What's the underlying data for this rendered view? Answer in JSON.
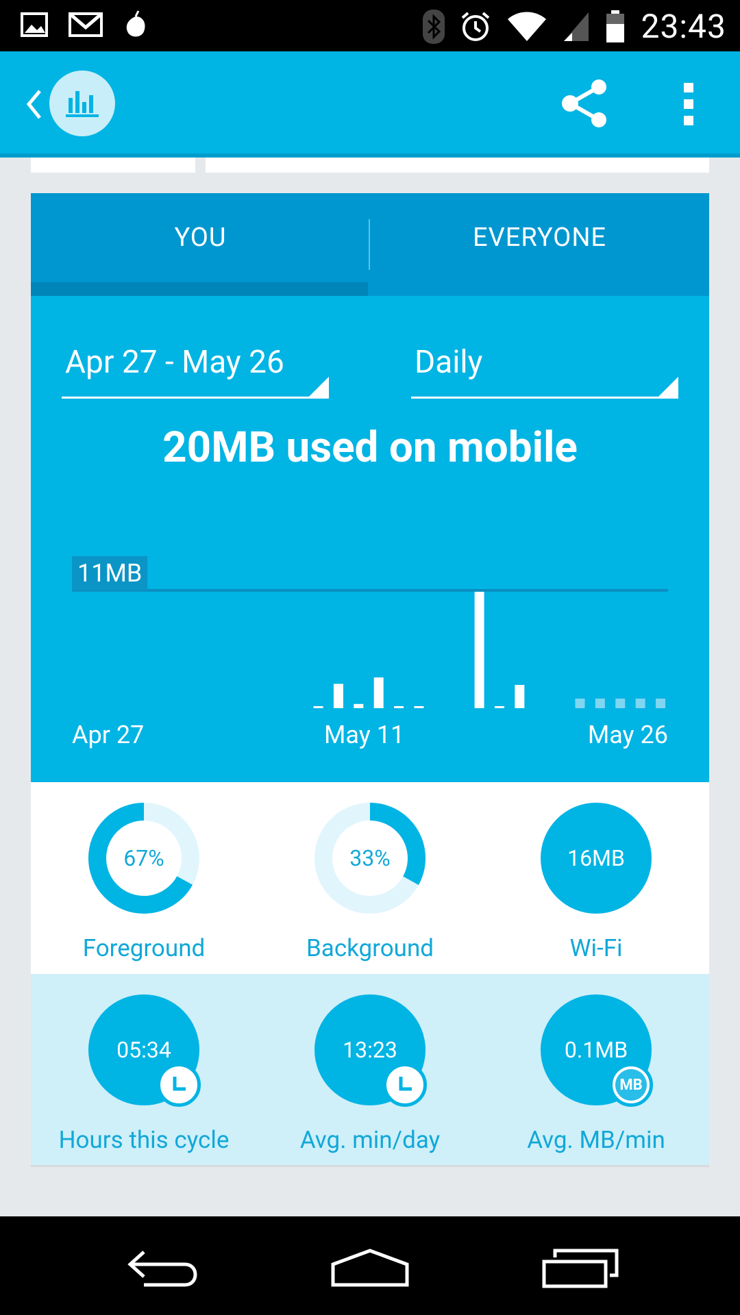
{
  "status_bar": {
    "time": "23:43",
    "left_icons": [
      "gallery-icon",
      "gmail-icon",
      "fruit-icon"
    ],
    "right_icons": [
      "bluetooth-icon",
      "alarm-icon",
      "wifi-icon",
      "cell-signal-icon",
      "battery-icon"
    ]
  },
  "app_bar": {
    "icons": [
      "back-chevron-icon",
      "bar-chart-logo-icon",
      "share-icon",
      "overflow-menu-icon"
    ]
  },
  "tabs": [
    {
      "label": "YOU",
      "selected": true
    },
    {
      "label": "EVERYONE",
      "selected": false
    }
  ],
  "filters": {
    "date_range": "Apr 27 - May 26",
    "period": "Daily"
  },
  "headline": "20MB used on mobile",
  "chart_data": {
    "type": "bar",
    "unit": "MB",
    "max_label": "11MB",
    "ylim": [
      0,
      11
    ],
    "x_tick_labels": [
      "Apr 27",
      "May 11",
      "May 26"
    ],
    "categories": [
      "Apr 27",
      "Apr 28",
      "Apr 29",
      "Apr 30",
      "May 1",
      "May 2",
      "May 3",
      "May 4",
      "May 5",
      "May 6",
      "May 7",
      "May 8",
      "May 9",
      "May 10",
      "May 11",
      "May 12",
      "May 13",
      "May 14",
      "May 15",
      "May 16",
      "May 17",
      "May 18",
      "May 19",
      "May 20",
      "May 21",
      "May 22",
      "May 23",
      "May 24",
      "May 25",
      "May 26"
    ],
    "values": [
      0,
      0,
      0,
      0,
      0,
      0,
      0,
      0,
      0,
      0,
      0,
      0,
      0.1,
      2.3,
      0.4,
      2.9,
      0.1,
      0.1,
      0,
      0,
      11,
      0.1,
      2.2,
      0,
      0,
      0,
      0,
      0,
      0,
      0
    ],
    "future_days": [
      "May 22",
      "May 23",
      "May 24",
      "May 25",
      "May 26"
    ],
    "colors": {
      "bar": "#ffffff",
      "future": "#7fd6f0",
      "max_line": "#0a8fc0"
    }
  },
  "stats_primary": [
    {
      "value": "67%",
      "label": "Foreground",
      "kind": "ring",
      "fraction": 0.67
    },
    {
      "value": "33%",
      "label": "Background",
      "kind": "ring",
      "fraction": 0.33
    },
    {
      "value": "16MB",
      "label": "Wi-Fi",
      "kind": "solid"
    }
  ],
  "stats_secondary": [
    {
      "value": "05:34",
      "label": "Hours this cycle",
      "badge": "clock-icon"
    },
    {
      "value": "13:23",
      "label": "Avg. min/day",
      "badge": "clock-icon"
    },
    {
      "value": "0.1MB",
      "label": "Avg. MB/min",
      "badge": "MB"
    }
  ],
  "nav_bar": {
    "icons": [
      "back-nav-icon",
      "home-nav-icon",
      "recents-nav-icon"
    ]
  },
  "colors": {
    "primary": "#00b4e4",
    "tab_bar": "#0097d0",
    "ring_track": "#e1f5fc",
    "light_panel": "#cfeff9"
  }
}
